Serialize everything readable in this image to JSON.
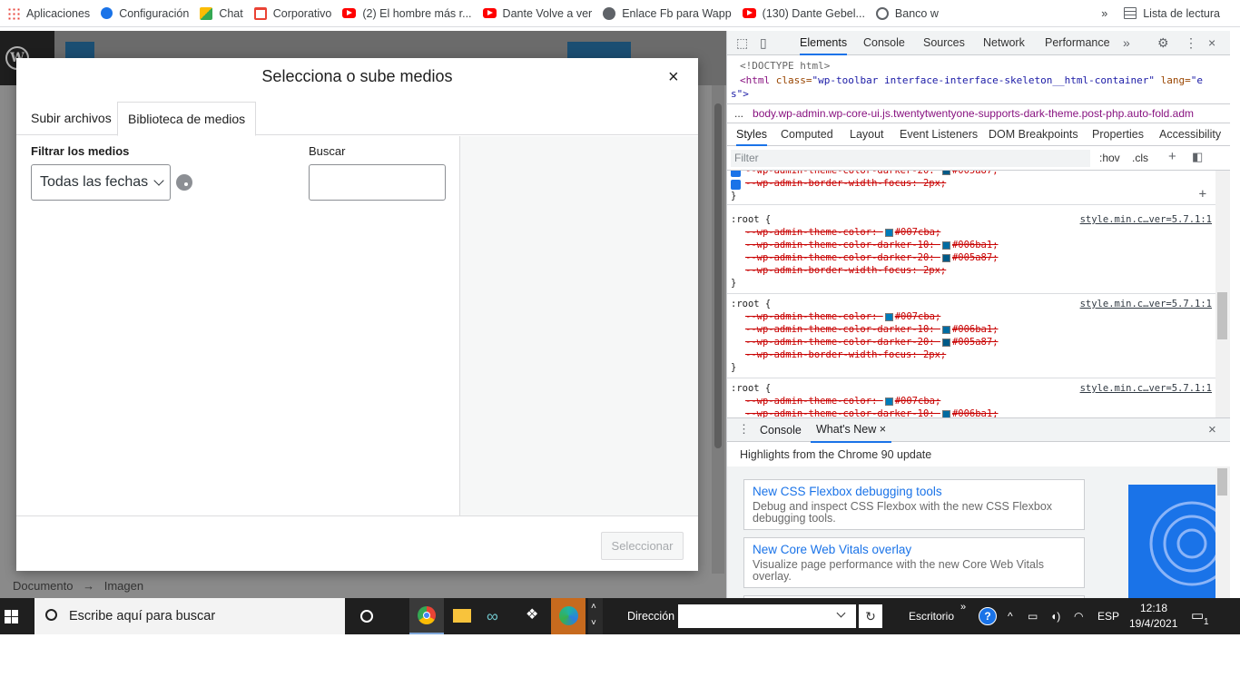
{
  "bookmarks": [
    {
      "label": "Aplicaciones",
      "icon": "apps-grid-icon"
    },
    {
      "label": "Configuración",
      "icon": "gear-icon"
    },
    {
      "label": "Chat",
      "icon": "chat-icon"
    },
    {
      "label": "Corporativo",
      "icon": "gmail-icon"
    },
    {
      "label": "(2) El hombre más r...",
      "icon": "youtube-icon"
    },
    {
      "label": "Dante Volve a ver",
      "icon": "youtube-icon"
    },
    {
      "label": "Enlace Fb para Wapp",
      "icon": "facebook-icon"
    },
    {
      "label": "(130) Dante Gebel...",
      "icon": "youtube-icon"
    },
    {
      "label": "Banco w",
      "icon": "globe-icon"
    }
  ],
  "bookmarks_more": "»",
  "reading_list": "Lista de lectura",
  "wp": {
    "footer_breadcrumb_1": "Documento",
    "footer_arrow": "→",
    "footer_breadcrumb_2": "Imagen"
  },
  "modal": {
    "title": "Selecciona o sube medios",
    "close": "×",
    "tabs": [
      "Subir archivos",
      "Biblioteca de medios"
    ],
    "active_tab": "Biblioteca de medios",
    "filter_label": "Filtrar los medios",
    "date_filter_value": "Todas las fechas",
    "search_label": "Buscar",
    "search_value": "",
    "select_button": "Seleccionar"
  },
  "devtools": {
    "tabs": [
      "Elements",
      "Console",
      "Sources",
      "Network",
      "Performance"
    ],
    "active_tab": "Elements",
    "more_tabs": "»",
    "dom_line1": "<!DOCTYPE html>",
    "dom_line2_tag": "<html",
    "dom_line2_attr1": " class=",
    "dom_line2_val1": "\"wp-toolbar interface-interface-skeleton__html-container\"",
    "dom_line2_attr2": " lang=",
    "dom_line2_val2": "\"e",
    "dom_line3": "s\">",
    "breadcrumb": "body.wp-admin.wp-core-ui.js.twentytwentyone-supports-dark-theme.post-php.auto-fold.adm",
    "breadcrumb_ellipsis": "...",
    "subtabs": [
      "Styles",
      "Computed",
      "Layout",
      "Event Listeners",
      "DOM Breakpoints",
      "Properties",
      "Accessibility"
    ],
    "active_subtab": "Styles",
    "filter_placeholder": "Filter",
    "hov": ":hov",
    "cls": ".cls",
    "top_rule_decls": [
      {
        "text": "--wp-admin-theme-color-darker-20: ",
        "swatch": "#005a87",
        "value": "#005a87;"
      },
      {
        "text": "--wp-admin-border-width-focus: 2px;",
        "swatch": null,
        "value": ""
      }
    ],
    "rules": [
      {
        "selector": ":root {",
        "source": "style.min.c…ver=5.7.1:1",
        "decls": [
          {
            "text": "--wp-admin-theme-color: ",
            "swatch": "#007cba",
            "value": "#007cba;"
          },
          {
            "text": "--wp-admin-theme-color-darker-10: ",
            "swatch": "#006ba1",
            "value": "#006ba1;"
          },
          {
            "text": "--wp-admin-theme-color-darker-20: ",
            "swatch": "#005a87",
            "value": "#005a87;"
          },
          {
            "text": "--wp-admin-border-width-focus: 2px;",
            "swatch": null,
            "value": ""
          }
        ]
      },
      {
        "selector": ":root {",
        "source": "style.min.c…ver=5.7.1:1",
        "decls": [
          {
            "text": "--wp-admin-theme-color: ",
            "swatch": "#007cba",
            "value": "#007cba;"
          },
          {
            "text": "--wp-admin-theme-color-darker-10: ",
            "swatch": "#006ba1",
            "value": "#006ba1;"
          },
          {
            "text": "--wp-admin-theme-color-darker-20: ",
            "swatch": "#005a87",
            "value": "#005a87;"
          },
          {
            "text": "--wp-admin-border-width-focus: 2px;",
            "swatch": null,
            "value": ""
          }
        ]
      },
      {
        "selector": ":root {",
        "source": "style.min.c…ver=5.7.1:1",
        "decls": [
          {
            "text": "--wp-admin-theme-color: ",
            "swatch": "#007cba",
            "value": "#007cba;"
          },
          {
            "text": "--wp-admin-theme-color-darker-10: ",
            "swatch": "#006ba1",
            "value": "#006ba1;"
          }
        ]
      }
    ],
    "close_brace": "}",
    "drawer_tabs": [
      "Console",
      "What's New"
    ],
    "drawer_active": "What's New",
    "drawer_tab_close": "×",
    "drawer_subtitle": "Highlights from the Chrome 90 update",
    "cards": [
      {
        "title": "New CSS Flexbox debugging tools",
        "desc": "Debug and inspect CSS Flexbox with the new CSS Flexbox debugging tools."
      },
      {
        "title": "New Core Web Vitals overlay",
        "desc": "Visualize page performance with the new Core Web Vitals overlay."
      }
    ],
    "close": "×"
  },
  "taskbar": {
    "search_placeholder": "Escribe aquí para buscar",
    "address_label": "Dirección",
    "desktop_label": "Escritorio",
    "more": "»",
    "language": "ESP",
    "time": "12:18",
    "date": "19/4/2021",
    "notification_count": "1"
  },
  "colors": {
    "wp_accent": "#007cba",
    "devtools_blue": "#1a73e8",
    "taskbar": "#1f1f1f"
  }
}
